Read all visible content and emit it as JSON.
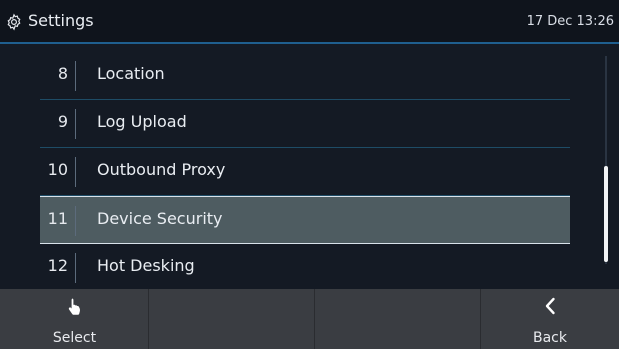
{
  "header": {
    "title": "Settings",
    "datetime": "17 Dec 13:26",
    "icon": "gear-icon"
  },
  "menu": {
    "items": [
      {
        "num": "8",
        "label": "Location",
        "selected": false
      },
      {
        "num": "9",
        "label": "Log Upload",
        "selected": false
      },
      {
        "num": "10",
        "label": "Outbound Proxy",
        "selected": false
      },
      {
        "num": "11",
        "label": "Device Security",
        "selected": true
      },
      {
        "num": "12",
        "label": "Hot Desking",
        "selected": false
      }
    ]
  },
  "softkeys": [
    {
      "label": "Select",
      "icon": "hand-pointer-icon"
    },
    {
      "label": "",
      "icon": ""
    },
    {
      "label": "",
      "icon": ""
    },
    {
      "label": "Back",
      "icon": "chevron-left-icon"
    }
  ],
  "colors": {
    "background": "#141a24",
    "header_border": "#1f5f8f",
    "selected_row": "#4e5c61",
    "softkey_bar": "#3a3d42"
  }
}
